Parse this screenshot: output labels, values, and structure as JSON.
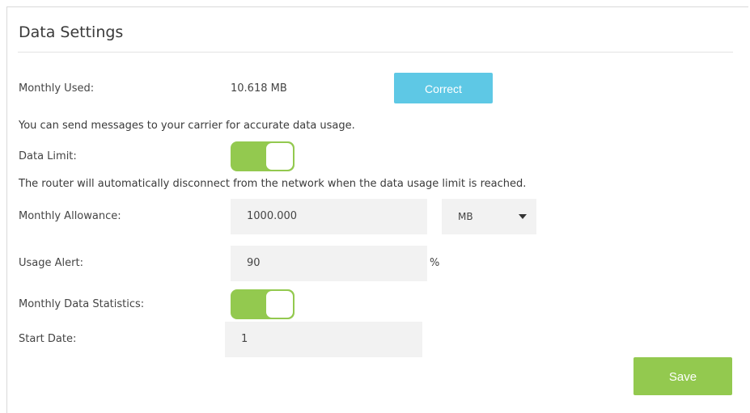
{
  "section": {
    "title": "Data Settings"
  },
  "monthly_used": {
    "label": "Monthly Used:",
    "value": "10.618 MB",
    "button_label": "Correct"
  },
  "carrier_note": "You can send messages to your carrier for accurate data usage.",
  "data_limit": {
    "label": "Data Limit:",
    "enabled": true
  },
  "limit_note": "The router will automatically disconnect from the network when the data usage limit is reached.",
  "monthly_allowance": {
    "label": "Monthly Allowance:",
    "value": "1000.000",
    "unit_selected": "MB"
  },
  "usage_alert": {
    "label": "Usage Alert:",
    "value": "90",
    "suffix": "%"
  },
  "monthly_statistics": {
    "label": "Monthly Data Statistics:",
    "enabled": true
  },
  "start_date": {
    "label": "Start Date:",
    "value": "1"
  },
  "actions": {
    "save_label": "Save"
  },
  "colors": {
    "toggle_on": "#93c94f",
    "correct_button": "#5ec8e5",
    "save_button": "#93c94f",
    "field_bg": "#f2f2f2"
  },
  "icons": {
    "select_caret": "caret-down-icon"
  }
}
